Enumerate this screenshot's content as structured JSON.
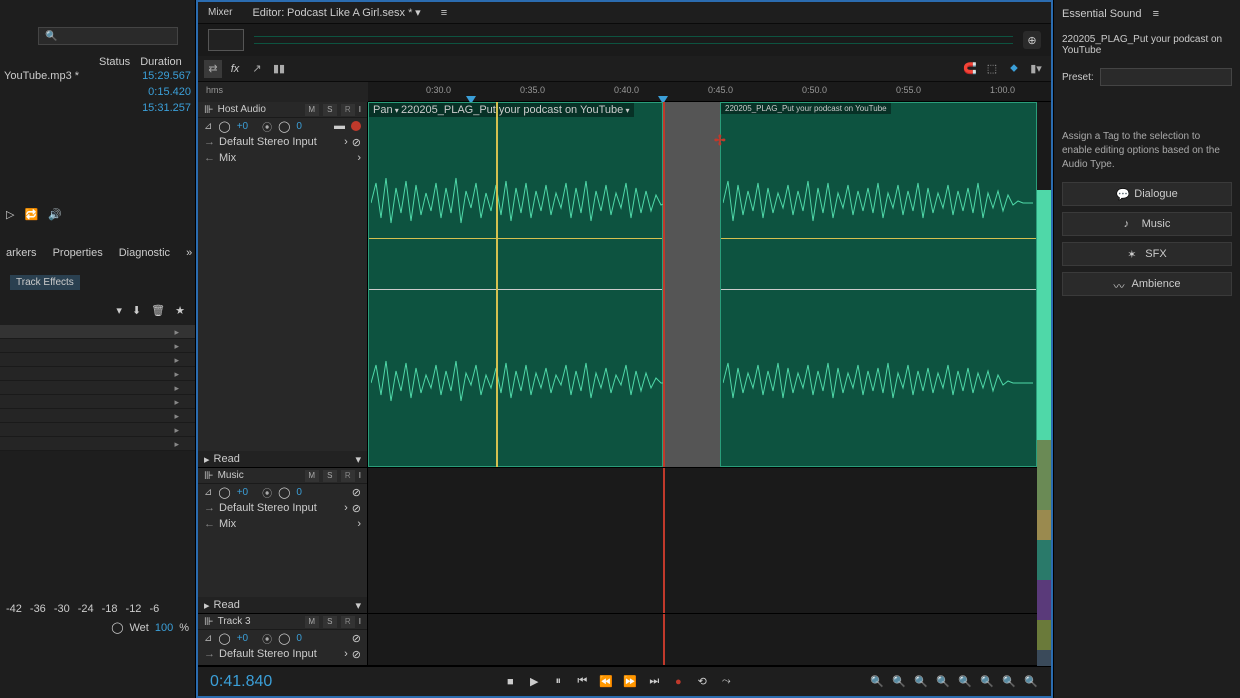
{
  "left": {
    "headers": {
      "status": "Status",
      "duration": "Duration"
    },
    "files": [
      {
        "name": "YouTube.mp3 *",
        "dur": "15:29.567"
      },
      {
        "name": "",
        "dur": "0:15.420"
      },
      {
        "name": "",
        "dur": "15:31.257"
      }
    ],
    "tabs": {
      "markers": "arkers",
      "properties": "Properties",
      "diagnostic": "Diagnostic"
    },
    "track_effects": "Track Effects",
    "db": [
      "-42",
      "-36",
      "-30",
      "-24",
      "-18",
      "-12",
      "-6"
    ],
    "wet_label": "Wet",
    "wet_val": "100",
    "wet_pct": "%"
  },
  "top": {
    "mixer": "Mixer",
    "editor_prefix": "Editor:",
    "editor_file": "Podcast Like A Girl.sesx *"
  },
  "ruler": {
    "hms": "hms",
    "ticks": [
      "0:30.0",
      "0:35.0",
      "0:40.0",
      "0:45.0",
      "0:50.0",
      "0:55.0",
      "1:00.0"
    ],
    "pan": "Pan"
  },
  "tracks": {
    "host": {
      "name": "Host Audio",
      "m": "M",
      "s": "S",
      "r": "R",
      "vol": "+0",
      "pan": "0",
      "input": "Default Stereo Input",
      "mix": "Mix",
      "read": "Read"
    },
    "music": {
      "name": "Music",
      "m": "M",
      "s": "S",
      "r": "R",
      "vol": "+0",
      "pan": "0",
      "input": "Default Stereo Input",
      "mix": "Mix",
      "read": "Read"
    },
    "track3": {
      "name": "Track 3",
      "m": "M",
      "s": "S",
      "r": "R",
      "vol": "+0",
      "pan": "0",
      "input": "Default Stereo Input"
    },
    "clip_label": "220205_PLAG_Put your podcast on YouTube"
  },
  "transport": {
    "timecode": "0:41.840"
  },
  "right": {
    "title": "Essential Sound",
    "file": "220205_PLAG_Put your podcast on YouTube",
    "preset_label": "Preset:",
    "hint": "Assign a Tag to the selection to enable editing options based on the Audio Type.",
    "dialogue": "Dialogue",
    "music": "Music",
    "sfx": "SFX",
    "ambience": "Ambience"
  }
}
